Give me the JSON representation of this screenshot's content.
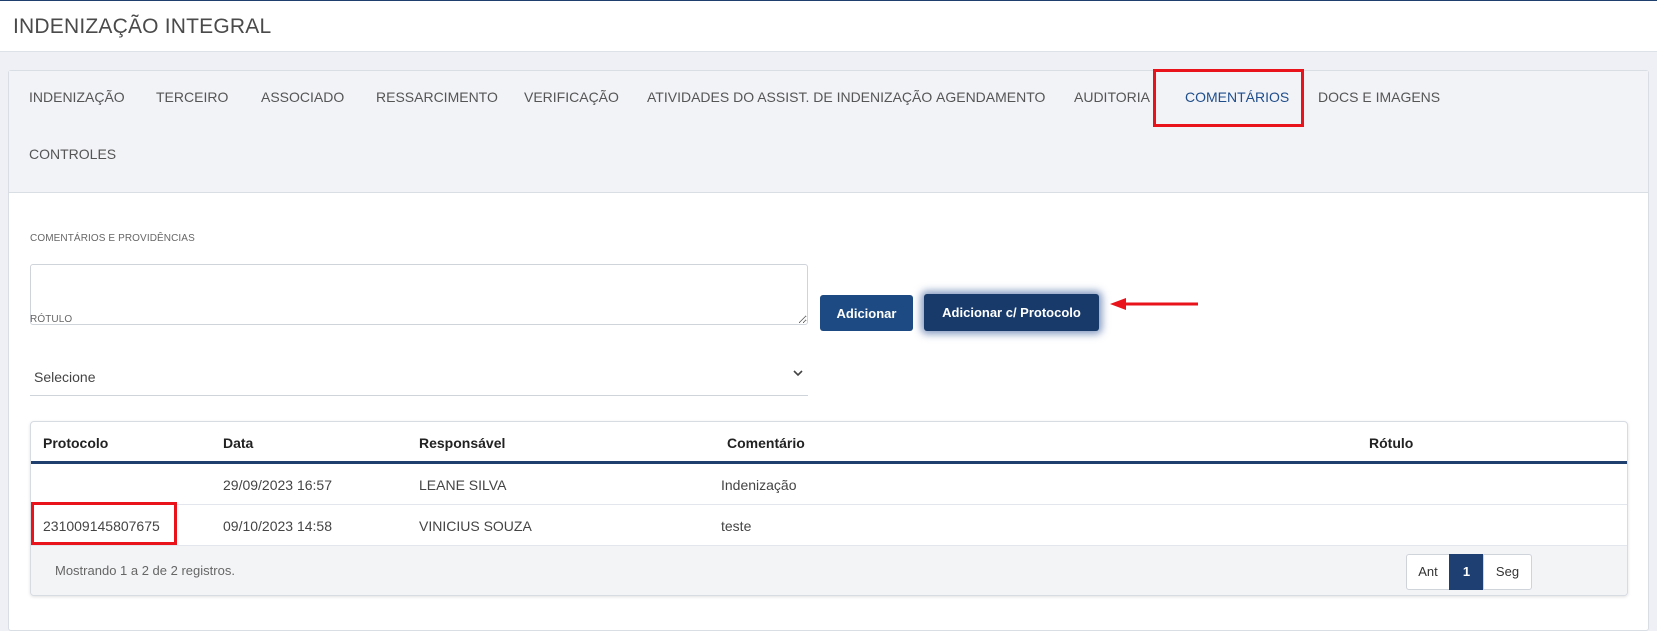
{
  "header": {
    "title": "INDENIZAÇÃO INTEGRAL"
  },
  "tabs": [
    {
      "label": "INDENIZAÇÃO"
    },
    {
      "label": "TERCEIRO"
    },
    {
      "label": "ASSOCIADO"
    },
    {
      "label": "RESSARCIMENTO"
    },
    {
      "label": "VERIFICAÇÃO"
    },
    {
      "label": "ATIVIDADES DO ASSIST. DE INDENIZAÇÃO"
    },
    {
      "label": "AGENDAMENTO"
    },
    {
      "label": "AUDITORIA"
    },
    {
      "label": "COMENTÁRIOS",
      "active": true
    },
    {
      "label": "DOCS E IMAGENS"
    },
    {
      "label": "CONTROLES"
    }
  ],
  "form": {
    "comments_label": "COMENTÁRIOS E PROVIDÊNCIAS",
    "comments_value": "",
    "add_button": "Adicionar",
    "add_protocol_button": "Adicionar c/ Protocolo",
    "tag_label": "RÓTULO",
    "tag_value": "Selecione"
  },
  "table": {
    "columns": [
      "Protocolo",
      "Data",
      "Responsável",
      "Comentário",
      "Rótulo"
    ],
    "rows": [
      [
        "",
        "29/09/2023 16:57",
        "LEANE SILVA",
        "Indenização",
        ""
      ],
      [
        "231009145807675",
        "09/10/2023 14:58",
        "VINICIUS SOUZA",
        "teste",
        ""
      ]
    ],
    "footer": "Mostrando 1 a 2 de 2 registros.",
    "pager": {
      "prev": "Ant",
      "current": "1",
      "next": "Seg"
    }
  },
  "colors": {
    "accent": "#1d4a82",
    "highlight": "#e8131b"
  },
  "icons": {
    "select": "chevron-down-icon",
    "annotation": "red-arrow-icon"
  }
}
